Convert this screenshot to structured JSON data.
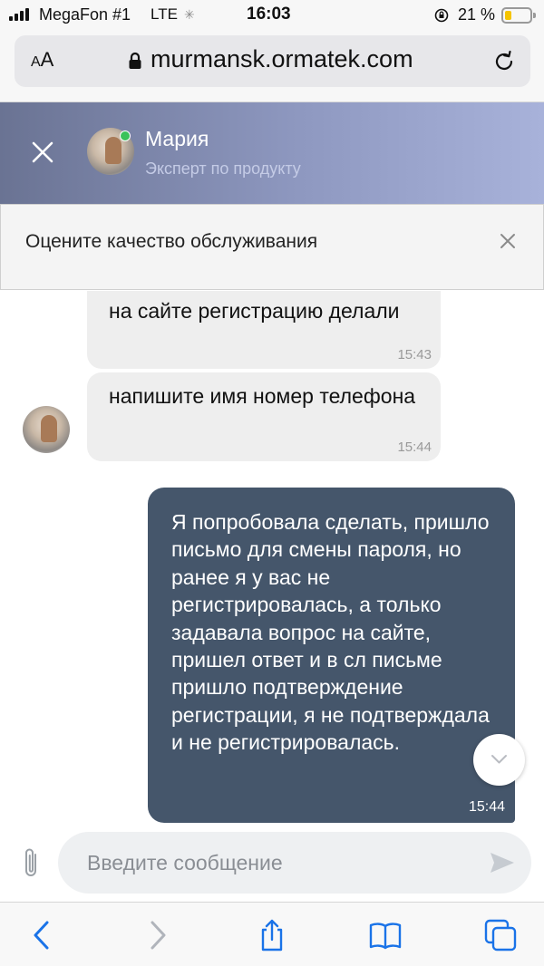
{
  "status_bar": {
    "carrier": "MegaFon #1",
    "network": "LTE",
    "time": "16:03",
    "battery": "21 %",
    "battery_level": 0.21
  },
  "browser": {
    "text_size_label": "AA",
    "url": "murmansk.ormatek.com"
  },
  "chat_header": {
    "agent_name": "Мария",
    "agent_role": "Эксперт по продукту",
    "online_color": "#3ac25a"
  },
  "rate_banner": {
    "text": "Оцените качество обслуживания"
  },
  "messages": [
    {
      "direction": "incoming",
      "text": "на сайте регистрацию делали",
      "time": "15:43"
    },
    {
      "direction": "incoming",
      "text": "напишите имя номер телефона",
      "time": "15:44"
    },
    {
      "direction": "outgoing",
      "text": "Я попробовала сделать, пришло письмо для смены пароля, но ранее я у вас не регистрировалась, а только задавала вопрос на сайте, пришел ответ и в сл письме пришло подтверждение регистрации, я не подтверждала и не регистрировалась.",
      "time": "15:44"
    }
  ],
  "composer": {
    "placeholder": "Введите сообщение",
    "value": ""
  },
  "colors": {
    "outgoing_bubble": "#45566b",
    "incoming_bubble": "#eeeeee",
    "toolbar_accent": "#1a73e8"
  },
  "icons": {
    "back": "chevron-left-icon",
    "forward": "chevron-right-icon",
    "share": "share-icon",
    "bookmarks": "book-icon",
    "tabs": "tabs-icon"
  }
}
